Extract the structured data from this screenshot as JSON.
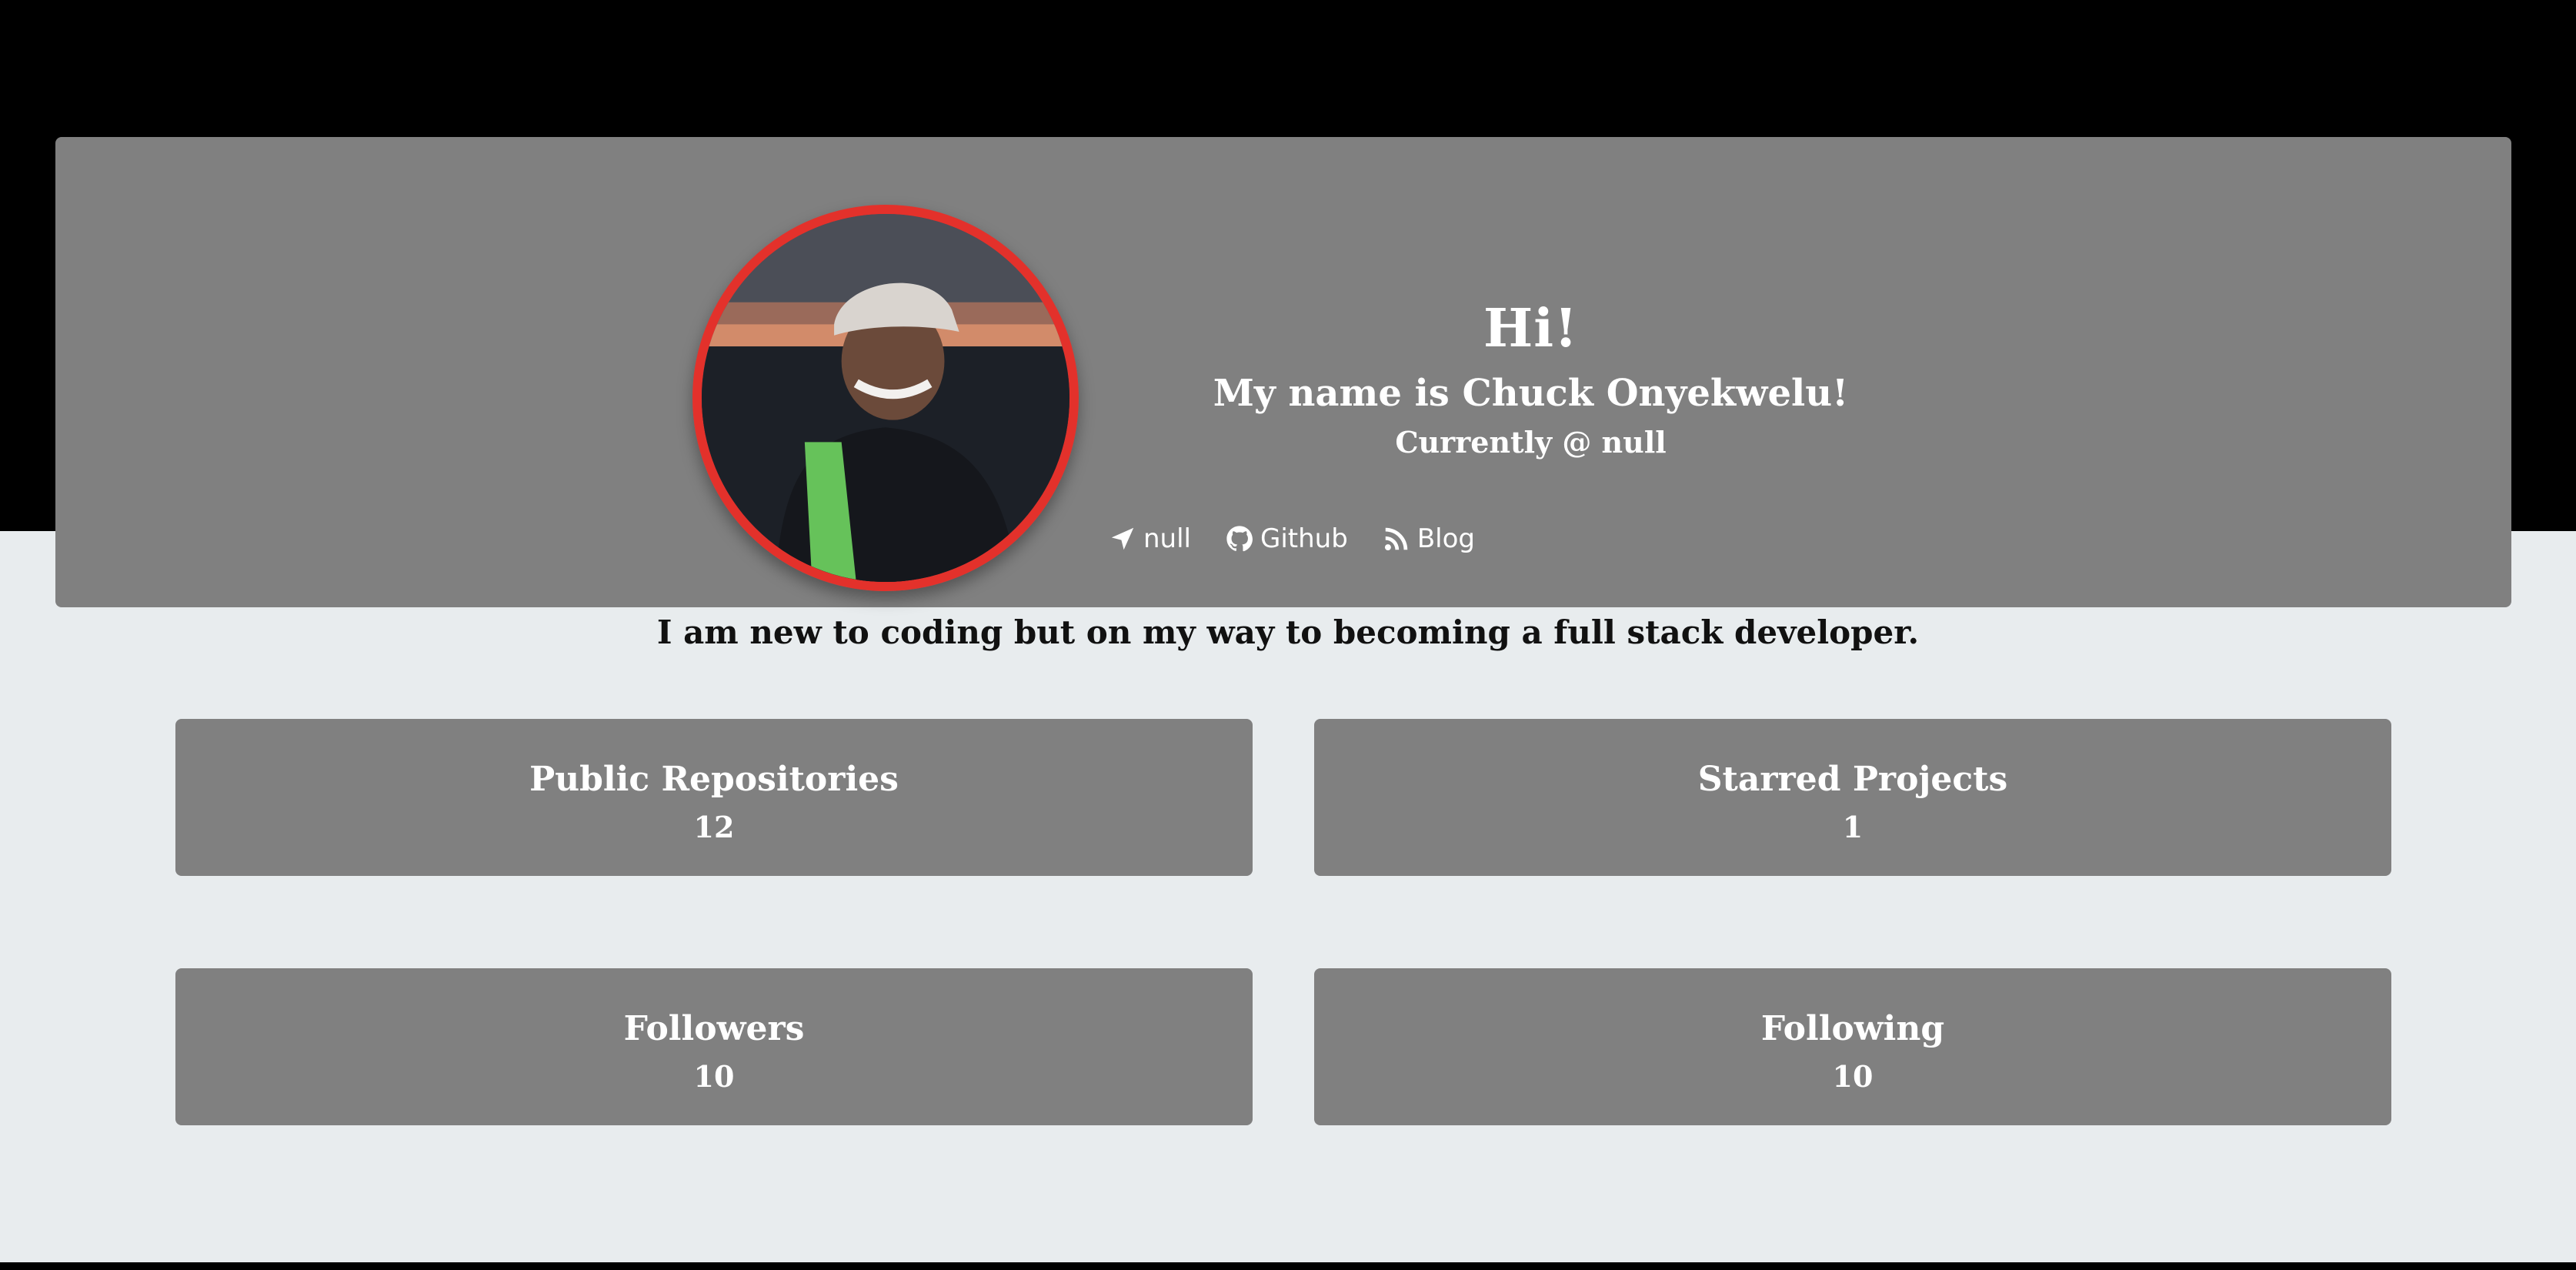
{
  "hero": {
    "greeting": "Hi!",
    "name_line": "My name is Chuck Onyekwelu!",
    "company_line": "Currently @ null",
    "avatar_alt": "Chuck Onyekwelu profile photo",
    "border_color": "#e3312b",
    "background_color": "#808080",
    "links": [
      {
        "icon": "location-arrow-icon",
        "label": "null"
      },
      {
        "icon": "github-icon",
        "label": "Github"
      },
      {
        "icon": "rss-icon",
        "label": "Blog"
      }
    ]
  },
  "bio": "I am new to coding but on my way to becoming a full stack developer.",
  "stats": [
    {
      "label": "Public Repositories",
      "value": "12"
    },
    {
      "label": "Starred Projects",
      "value": "1"
    },
    {
      "label": "Followers",
      "value": "10"
    },
    {
      "label": "Following",
      "value": "10"
    }
  ]
}
